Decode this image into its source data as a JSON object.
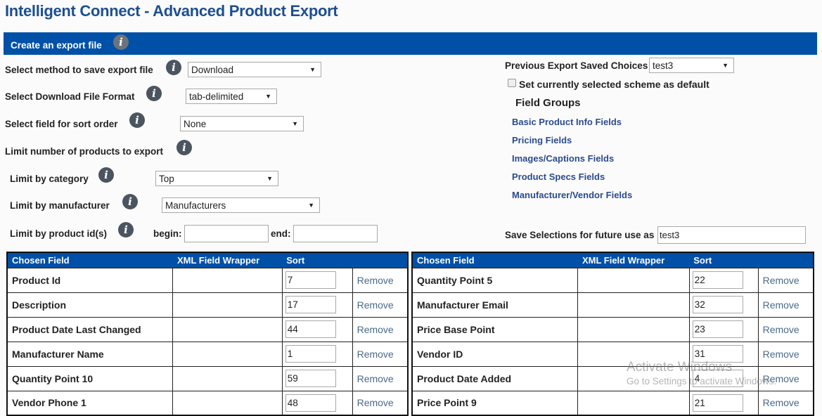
{
  "page": {
    "title": "Intelligent Connect - Advanced Product Export"
  },
  "section": {
    "title": "Create an export file",
    "info_icon": "info-icon"
  },
  "form": {
    "save_method": {
      "label": "Select method to save export file",
      "value": "Download"
    },
    "file_format": {
      "label": "Select Download File Format",
      "value": "tab-delimited"
    },
    "sort_field": {
      "label": "Select field for sort order",
      "value": "None"
    },
    "limit_heading": {
      "label": "Limit number of products to export"
    },
    "limit_category": {
      "label": "Limit by category",
      "value": "Top"
    },
    "limit_manufacturer": {
      "label": "Limit by manufacturer",
      "value": "Manufacturers"
    },
    "limit_product_ids": {
      "label": "Limit by product id(s)",
      "begin_label": "begin:",
      "begin_value": "",
      "end_label": "end:",
      "end_value": ""
    }
  },
  "right_panel": {
    "previous_choices": {
      "label": "Previous Export Saved Choices",
      "value": "test3"
    },
    "default_checkbox": {
      "label": "Set currently selected scheme as default",
      "checked": false
    },
    "field_groups": {
      "title": "Field Groups",
      "links": [
        "Basic Product Info Fields",
        "Pricing Fields",
        "Images/Captions Fields",
        "Product Specs Fields",
        "Manufacturer/Vendor Fields"
      ]
    },
    "save_selections": {
      "label": "Save Selections for future use as",
      "value": "test3"
    }
  },
  "tables": {
    "headers": {
      "field": "Chosen Field",
      "wrapper": "XML Field Wrapper",
      "sort": "Sort"
    },
    "remove_label": "Remove",
    "left": [
      {
        "field": "Product Id",
        "wrapper": "",
        "sort": "7"
      },
      {
        "field": "Description",
        "wrapper": "",
        "sort": "17"
      },
      {
        "field": "Product Date Last Changed",
        "wrapper": "",
        "sort": "44"
      },
      {
        "field": "Manufacturer Name",
        "wrapper": "",
        "sort": "1"
      },
      {
        "field": "Quantity Point 10",
        "wrapper": "",
        "sort": "59"
      },
      {
        "field": "Vendor Phone 1",
        "wrapper": "",
        "sort": "48"
      }
    ],
    "right": [
      {
        "field": "Quantity Point 5",
        "wrapper": "",
        "sort": "22"
      },
      {
        "field": "Manufacturer Email",
        "wrapper": "",
        "sort": "32"
      },
      {
        "field": "Price Base Point",
        "wrapper": "",
        "sort": "23"
      },
      {
        "field": "Vendor ID",
        "wrapper": "",
        "sort": "31"
      },
      {
        "field": "Product Date Added",
        "wrapper": "",
        "sort": "4"
      },
      {
        "field": "Price Point 9",
        "wrapper": "",
        "sort": "21"
      }
    ]
  },
  "watermark": {
    "line1": "Activate Windows",
    "line2": "Go to Settings to activate Windows."
  },
  "colors": {
    "brand_blue": "#0050a8",
    "title_blue": "#1d4f91",
    "link_blue": "#2a4b8d"
  }
}
